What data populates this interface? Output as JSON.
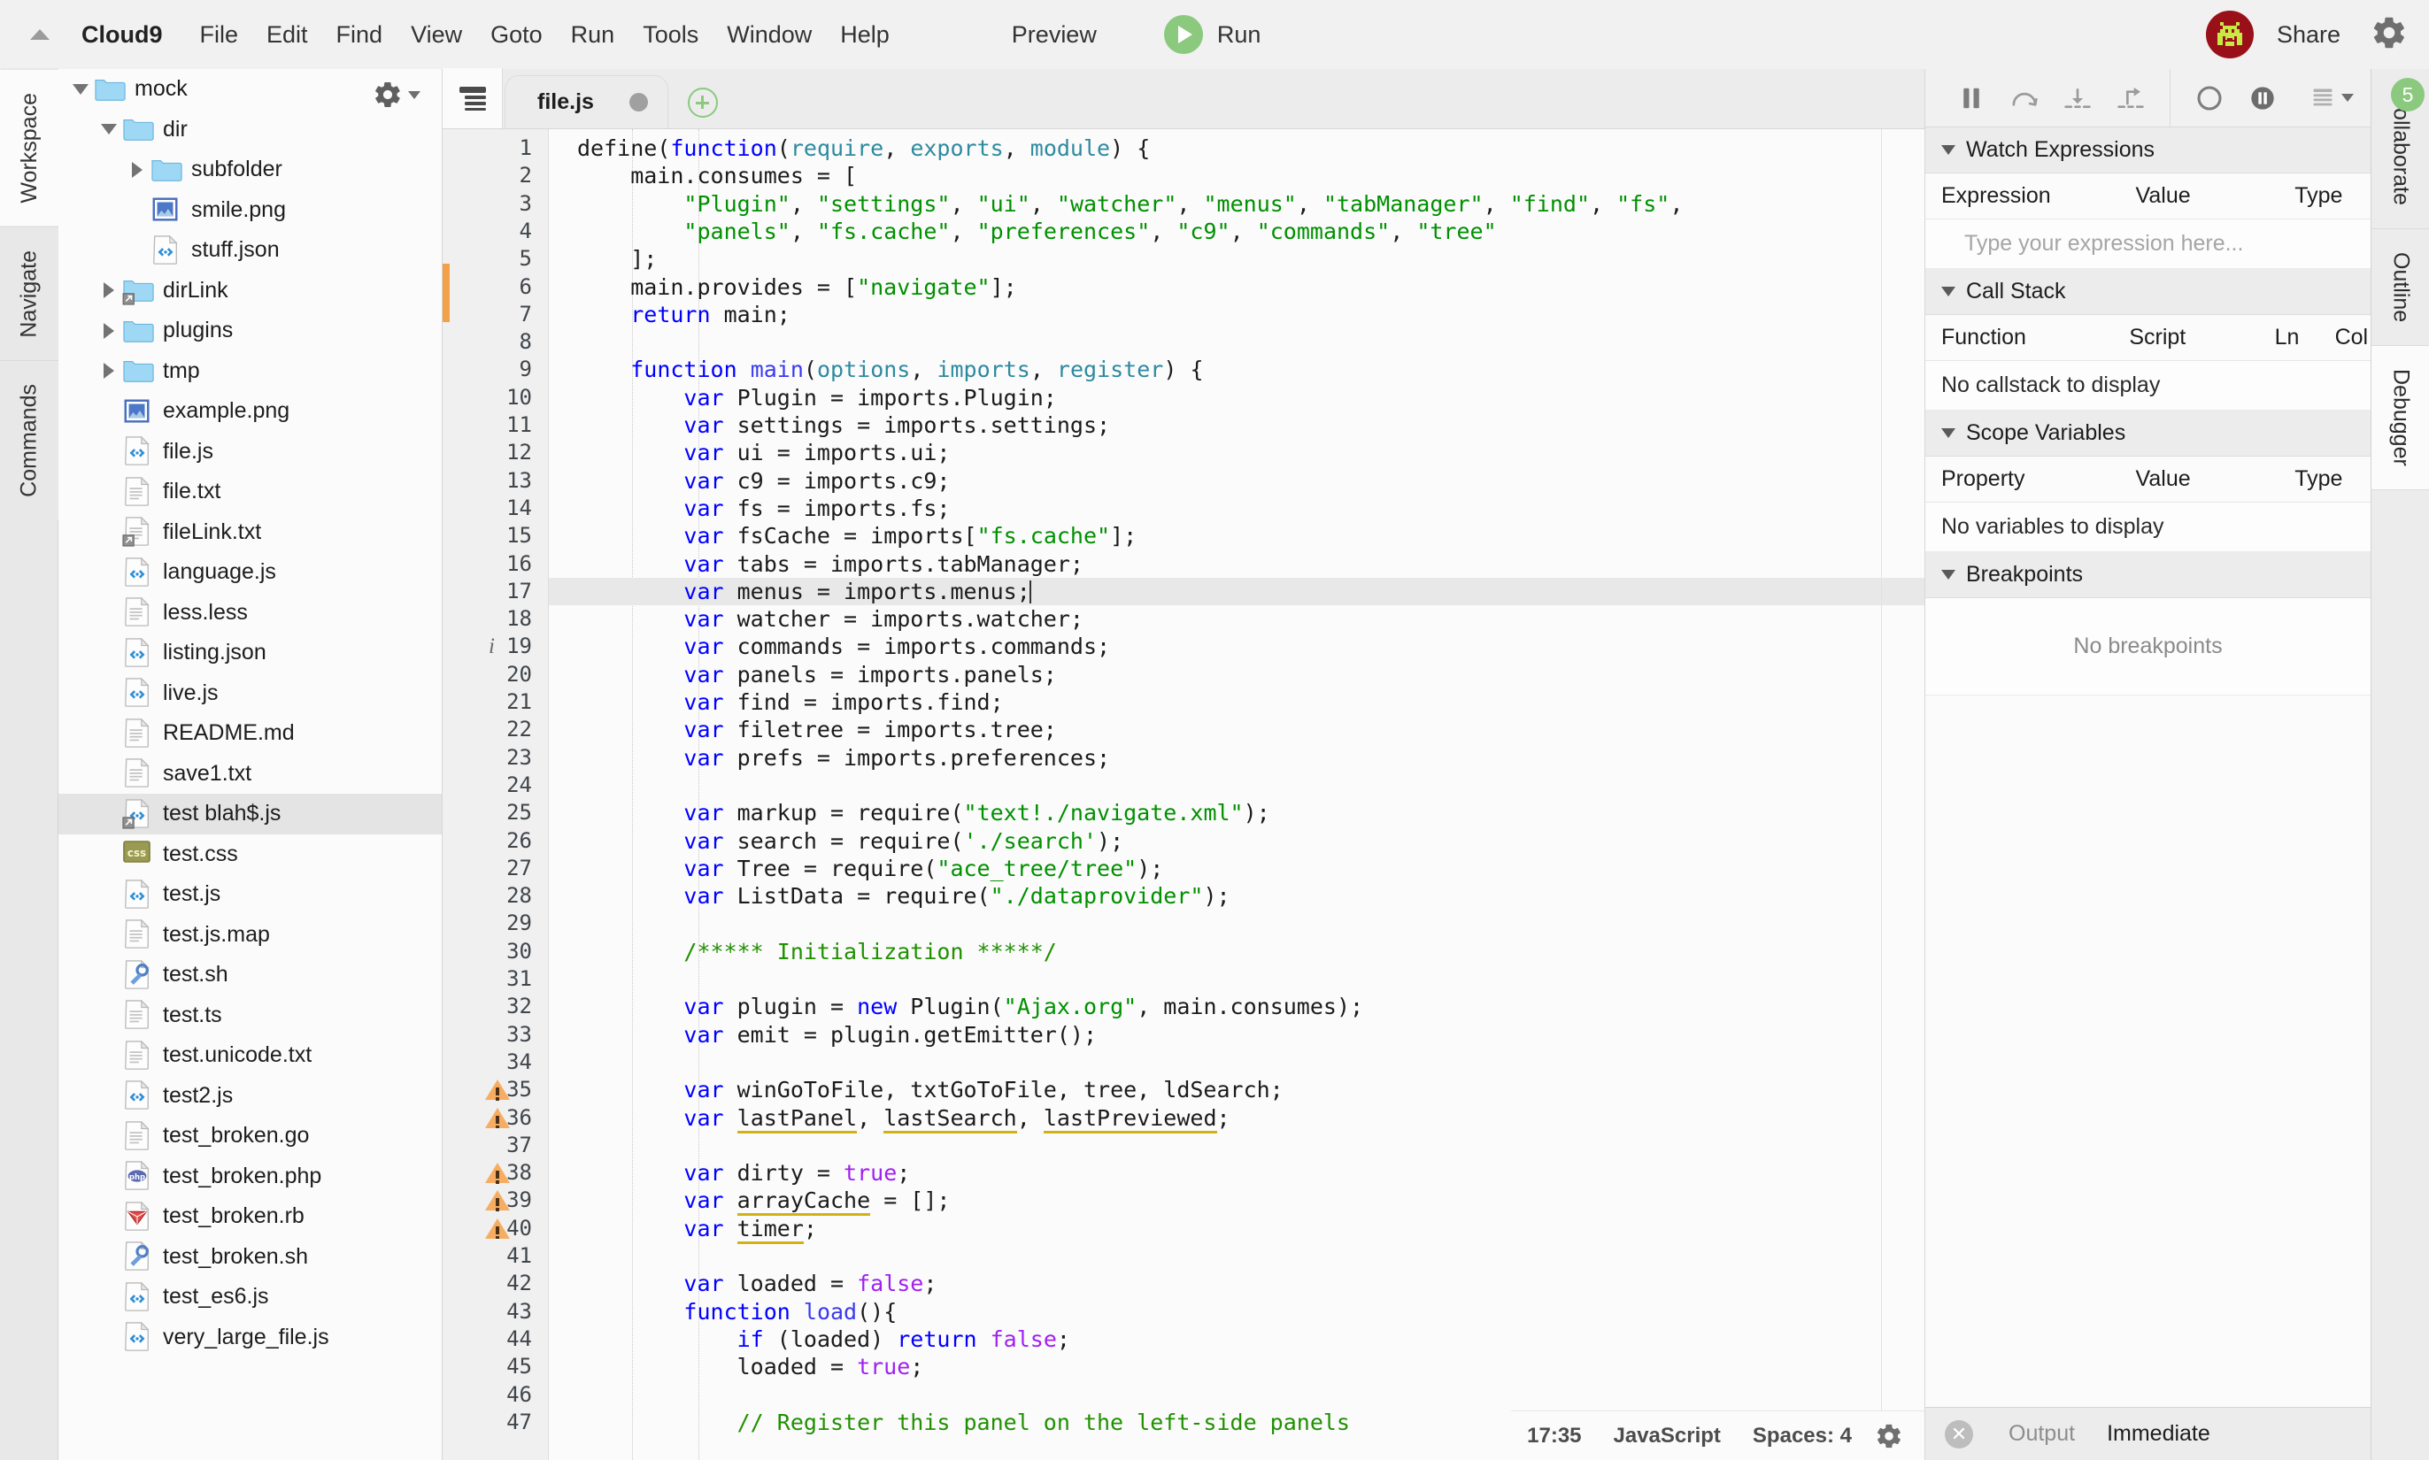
{
  "menubar": {
    "collapse_icon": "triangle-up-icon",
    "brand": "Cloud9",
    "items": [
      "File",
      "Edit",
      "Find",
      "View",
      "Goto",
      "Run",
      "Tools",
      "Window",
      "Help"
    ],
    "preview_label": "Preview",
    "run_label": "Run",
    "run_icon": "play-icon",
    "share_label": "Share",
    "settings_icon": "gear-icon",
    "avatar_icon": "user-avatar-icon",
    "accent_green": "#8bc97e",
    "avatar_bg": "#9a1018",
    "avatar_fg": "#c8e845"
  },
  "left_rail": {
    "tabs": [
      {
        "label": "Workspace",
        "active": true
      },
      {
        "label": "Navigate",
        "active": false
      },
      {
        "label": "Commands",
        "active": false
      }
    ]
  },
  "tree": {
    "gear_icon": "gear-icon",
    "gear_caret_icon": "chevron-down-icon",
    "items": [
      {
        "name": "mock",
        "indent": 0,
        "icon": "folder-open-icon",
        "twisty": "open",
        "selected": false
      },
      {
        "name": "dir",
        "indent": 1,
        "icon": "folder-open-icon",
        "twisty": "open",
        "selected": false
      },
      {
        "name": "subfolder",
        "indent": 2,
        "icon": "folder-icon",
        "twisty": "closed",
        "selected": false
      },
      {
        "name": "smile.png",
        "indent": 2,
        "icon": "image-file-icon",
        "twisty": "none",
        "selected": false
      },
      {
        "name": "stuff.json",
        "indent": 2,
        "icon": "code-file-icon",
        "twisty": "none",
        "selected": false
      },
      {
        "name": "dirLink",
        "indent": 1,
        "icon": "folder-link-icon",
        "twisty": "closed",
        "selected": false
      },
      {
        "name": "plugins",
        "indent": 1,
        "icon": "folder-icon",
        "twisty": "closed",
        "selected": false
      },
      {
        "name": "tmp",
        "indent": 1,
        "icon": "folder-icon",
        "twisty": "closed",
        "selected": false
      },
      {
        "name": "example.png",
        "indent": 1,
        "icon": "image-file-icon",
        "twisty": "none",
        "selected": false
      },
      {
        "name": "file.js",
        "indent": 1,
        "icon": "code-file-icon",
        "twisty": "none",
        "selected": false
      },
      {
        "name": "file.txt",
        "indent": 1,
        "icon": "text-file-icon",
        "twisty": "none",
        "selected": false
      },
      {
        "name": "fileLink.txt",
        "indent": 1,
        "icon": "text-file-link-icon",
        "twisty": "none",
        "selected": false
      },
      {
        "name": "language.js",
        "indent": 1,
        "icon": "code-file-icon",
        "twisty": "none",
        "selected": false
      },
      {
        "name": "less.less",
        "indent": 1,
        "icon": "text-file-icon",
        "twisty": "none",
        "selected": false
      },
      {
        "name": "listing.json",
        "indent": 1,
        "icon": "code-file-icon",
        "twisty": "none",
        "selected": false
      },
      {
        "name": "live.js",
        "indent": 1,
        "icon": "code-file-icon",
        "twisty": "none",
        "selected": false
      },
      {
        "name": "README.md",
        "indent": 1,
        "icon": "text-file-icon",
        "twisty": "none",
        "selected": false
      },
      {
        "name": "save1.txt",
        "indent": 1,
        "icon": "text-file-icon",
        "twisty": "none",
        "selected": false
      },
      {
        "name": "test blah$.js",
        "indent": 1,
        "icon": "code-file-link-icon",
        "twisty": "none",
        "selected": true
      },
      {
        "name": "test.css",
        "indent": 1,
        "icon": "css-file-icon",
        "twisty": "none",
        "selected": false
      },
      {
        "name": "test.js",
        "indent": 1,
        "icon": "code-file-icon",
        "twisty": "none",
        "selected": false
      },
      {
        "name": "test.js.map",
        "indent": 1,
        "icon": "text-file-icon",
        "twisty": "none",
        "selected": false
      },
      {
        "name": "test.sh",
        "indent": 1,
        "icon": "shell-file-icon",
        "twisty": "none",
        "selected": false
      },
      {
        "name": "test.ts",
        "indent": 1,
        "icon": "text-file-icon",
        "twisty": "none",
        "selected": false
      },
      {
        "name": "test.unicode.txt",
        "indent": 1,
        "icon": "text-file-icon",
        "twisty": "none",
        "selected": false
      },
      {
        "name": "test2.js",
        "indent": 1,
        "icon": "code-file-icon",
        "twisty": "none",
        "selected": false
      },
      {
        "name": "test_broken.go",
        "indent": 1,
        "icon": "text-file-icon",
        "twisty": "none",
        "selected": false
      },
      {
        "name": "test_broken.php",
        "indent": 1,
        "icon": "php-file-icon",
        "twisty": "none",
        "selected": false
      },
      {
        "name": "test_broken.rb",
        "indent": 1,
        "icon": "ruby-file-icon",
        "twisty": "none",
        "selected": false
      },
      {
        "name": "test_broken.sh",
        "indent": 1,
        "icon": "shell-file-icon",
        "twisty": "none",
        "selected": false
      },
      {
        "name": "test_es6.js",
        "indent": 1,
        "icon": "code-file-icon",
        "twisty": "none",
        "selected": false
      },
      {
        "name": "very_large_file.js",
        "indent": 1,
        "icon": "code-file-icon",
        "twisty": "none",
        "selected": false
      }
    ]
  },
  "editor": {
    "tabbar_icon": "tab-list-icon",
    "tab": {
      "title": "file.js",
      "dirty": true
    },
    "add_tab_icon": "plus-icon",
    "active_line": 17,
    "warning_lines": [
      35,
      36,
      38,
      39,
      40
    ],
    "info_lines": [
      19
    ],
    "lines": [
      {
        "n": 1,
        "t": "define(function(require, exports, module) {"
      },
      {
        "n": 2,
        "t": "    main.consumes = ["
      },
      {
        "n": 3,
        "t": "        \"Plugin\", \"settings\", \"ui\", \"watcher\", \"menus\", \"tabManager\", \"find\", \"fs\","
      },
      {
        "n": 4,
        "t": "        \"panels\", \"fs.cache\", \"preferences\", \"c9\", \"commands\", \"tree\""
      },
      {
        "n": 5,
        "t": "    ];"
      },
      {
        "n": 6,
        "t": "    main.provides = [\"navigate\"];"
      },
      {
        "n": 7,
        "t": "    return main;"
      },
      {
        "n": 8,
        "t": ""
      },
      {
        "n": 9,
        "t": "    function main(options, imports, register) {"
      },
      {
        "n": 10,
        "t": "        var Plugin = imports.Plugin;"
      },
      {
        "n": 11,
        "t": "        var settings = imports.settings;"
      },
      {
        "n": 12,
        "t": "        var ui = imports.ui;"
      },
      {
        "n": 13,
        "t": "        var c9 = imports.c9;"
      },
      {
        "n": 14,
        "t": "        var fs = imports.fs;"
      },
      {
        "n": 15,
        "t": "        var fsCache = imports[\"fs.cache\"];"
      },
      {
        "n": 16,
        "t": "        var tabs = imports.tabManager;"
      },
      {
        "n": 17,
        "t": "        var menus = imports.menus;"
      },
      {
        "n": 18,
        "t": "        var watcher = imports.watcher;"
      },
      {
        "n": 19,
        "t": "        var commands = imports.commands;"
      },
      {
        "n": 20,
        "t": "        var panels = imports.panels;"
      },
      {
        "n": 21,
        "t": "        var find = imports.find;"
      },
      {
        "n": 22,
        "t": "        var filetree = imports.tree;"
      },
      {
        "n": 23,
        "t": "        var prefs = imports.preferences;"
      },
      {
        "n": 24,
        "t": ""
      },
      {
        "n": 25,
        "t": "        var markup = require(\"text!./navigate.xml\");"
      },
      {
        "n": 26,
        "t": "        var search = require('./search');"
      },
      {
        "n": 27,
        "t": "        var Tree = require(\"ace_tree/tree\");"
      },
      {
        "n": 28,
        "t": "        var ListData = require(\"./dataprovider\");"
      },
      {
        "n": 29,
        "t": ""
      },
      {
        "n": 30,
        "t": "        /***** Initialization *****/"
      },
      {
        "n": 31,
        "t": ""
      },
      {
        "n": 32,
        "t": "        var plugin = new Plugin(\"Ajax.org\", main.consumes);"
      },
      {
        "n": 33,
        "t": "        var emit = plugin.getEmitter();"
      },
      {
        "n": 34,
        "t": ""
      },
      {
        "n": 35,
        "t": "        var winGoToFile, txtGoToFile, tree, ldSearch;"
      },
      {
        "n": 36,
        "t": "        var lastPanel, lastSearch, lastPreviewed;"
      },
      {
        "n": 37,
        "t": ""
      },
      {
        "n": 38,
        "t": "        var dirty = true;"
      },
      {
        "n": 39,
        "t": "        var arrayCache = [];"
      },
      {
        "n": 40,
        "t": "        var timer;"
      },
      {
        "n": 41,
        "t": ""
      },
      {
        "n": 42,
        "t": "        var loaded = false;"
      },
      {
        "n": 43,
        "t": "        function load(){"
      },
      {
        "n": 44,
        "t": "            if (loaded) return false;"
      },
      {
        "n": 45,
        "t": "            loaded = true;"
      },
      {
        "n": 46,
        "t": ""
      },
      {
        "n": 47,
        "t": "            // Register this panel on the left-side panels"
      }
    ],
    "status": {
      "position": "17:35",
      "language": "JavaScript",
      "indent": "Spaces: 4",
      "settings_icon": "gear-icon"
    }
  },
  "debugger": {
    "toolbar": [
      {
        "name": "resume-button",
        "icon": "pause-icon"
      },
      {
        "name": "step-over-button",
        "icon": "step-over-icon"
      },
      {
        "name": "step-into-button",
        "icon": "step-into-icon"
      },
      {
        "name": "step-out-button",
        "icon": "step-out-icon"
      },
      {
        "name": "breakpoint-toggle",
        "icon": "circle-icon"
      },
      {
        "name": "pause-exceptions",
        "icon": "pause-circle-icon"
      },
      {
        "name": "debug-options-menu",
        "icon": "list-icon"
      }
    ],
    "sections": [
      {
        "title": "Watch Expressions",
        "columns": [
          "Expression",
          "Value",
          "Type"
        ],
        "placeholder": "Type your expression here..."
      },
      {
        "title": "Call Stack",
        "columns": [
          "Function",
          "Script",
          "Ln",
          "Col"
        ],
        "empty": "No callstack to display"
      },
      {
        "title": "Scope Variables",
        "columns": [
          "Property",
          "Value",
          "Type"
        ],
        "empty": "No variables to display"
      },
      {
        "title": "Breakpoints",
        "empty": "No breakpoints"
      }
    ]
  },
  "right_rail": {
    "tabs": [
      {
        "label": "Collaborate",
        "badge": "5",
        "active": false
      },
      {
        "label": "Outline",
        "badge": "",
        "active": false
      },
      {
        "label": "Debugger",
        "badge": "",
        "active": true
      }
    ]
  },
  "console": {
    "close_icon": "close-icon",
    "tabs": [
      {
        "label": "Output",
        "active": false
      },
      {
        "label": "Immediate",
        "active": true
      }
    ]
  }
}
